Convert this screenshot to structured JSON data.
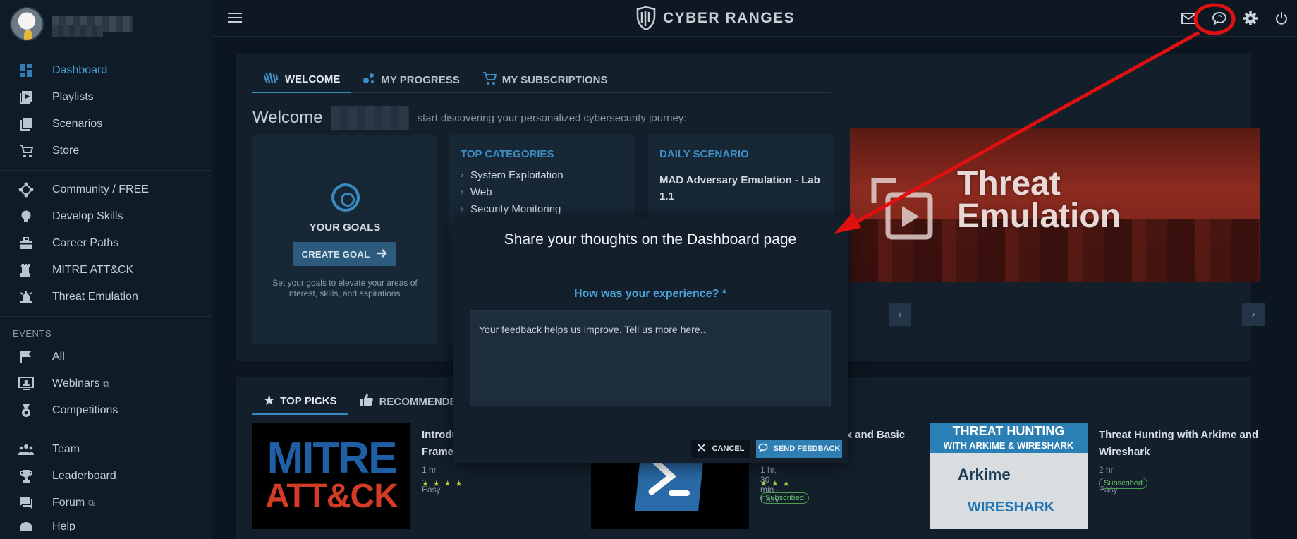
{
  "sidebar": {
    "nav_main": [
      {
        "label": "Dashboard",
        "icon": "dashboard-icon"
      },
      {
        "label": "Playlists",
        "icon": "playlist-icon"
      },
      {
        "label": "Scenarios",
        "icon": "scenarios-icon"
      },
      {
        "label": "Store",
        "icon": "cart-icon"
      }
    ],
    "nav_secondary": [
      {
        "label": "Community / FREE",
        "icon": "community-icon"
      },
      {
        "label": "Develop Skills",
        "icon": "lightbulb-icon"
      },
      {
        "label": "Career Paths",
        "icon": "briefcase-icon"
      },
      {
        "label": "MITRE ATT&CK",
        "icon": "rook-icon"
      },
      {
        "label": "Threat Emulation",
        "icon": "alarm-icon"
      }
    ],
    "events_title": "EVENTS",
    "nav_events": [
      {
        "label": "All",
        "icon": "flag-icon"
      },
      {
        "label": "Webinars",
        "icon": "presenter-icon"
      },
      {
        "label": "Competitions",
        "icon": "medal-icon"
      }
    ],
    "nav_community": [
      {
        "label": "Team",
        "icon": "team-icon"
      },
      {
        "label": "Leaderboard",
        "icon": "trophy-icon"
      },
      {
        "label": "Forum",
        "icon": "forum-icon"
      },
      {
        "label": "Help",
        "icon": "help-icon"
      }
    ]
  },
  "topbar": {
    "logo_text": "CYBER RANGES"
  },
  "welcome": {
    "tabs": [
      "WELCOME",
      "MY PROGRESS",
      "MY SUBSCRIPTIONS"
    ],
    "greeting": "Welcome",
    "subtitle": "start discovering your personalized cybersecurity journey:",
    "goals_title": "YOUR GOALS",
    "create_goal": "CREATE GOAL",
    "goals_desc": "Set your goals to elevate your areas of interest, skills, and aspirations.",
    "categories_title": "TOP CATEGORIES",
    "categories": [
      "System Exploitation",
      "Web",
      "Security Monitoring"
    ],
    "daily_title": "DAILY SCENARIO",
    "daily_name": "MAD Adversary Emulation - Lab 1.1",
    "banner_text_1": "Threat",
    "banner_text_2": "Emulation"
  },
  "picks": {
    "tabs": [
      "TOP PICKS",
      "RECOMMENDED"
    ],
    "items": [
      {
        "title": "Introduction to MITRE ATT&CK Framework",
        "meta": "1 hr  ·  Easy"
      },
      {
        "title": "PowerShell: Linux and Basic",
        "meta": "1 hr, 30 min  ·  Easy",
        "badge": "Subscribed"
      },
      {
        "title": "Threat Hunting with Arkime and Wireshark",
        "meta": "2 hr  ·  Easy",
        "badge": "Subscribed"
      }
    ],
    "mitre_line1": "MITRE",
    "mitre_line2": "ATT&CK",
    "th_line1": "THREAT HUNTING",
    "th_line2": "WITH ARKIME & WIRESHARK",
    "th_arkime": "Arkime",
    "th_wireshark": "WIRESHARK"
  },
  "modal": {
    "title": "Share your thoughts on the Dashboard page",
    "question": "How was your experience? *",
    "placeholder": "Your feedback helps us improve. Tell us more here...",
    "cancel": "CANCEL",
    "send": "SEND FEEDBACK"
  },
  "colors": {
    "accent": "#3a8ac1",
    "annotation": "#e01010"
  }
}
